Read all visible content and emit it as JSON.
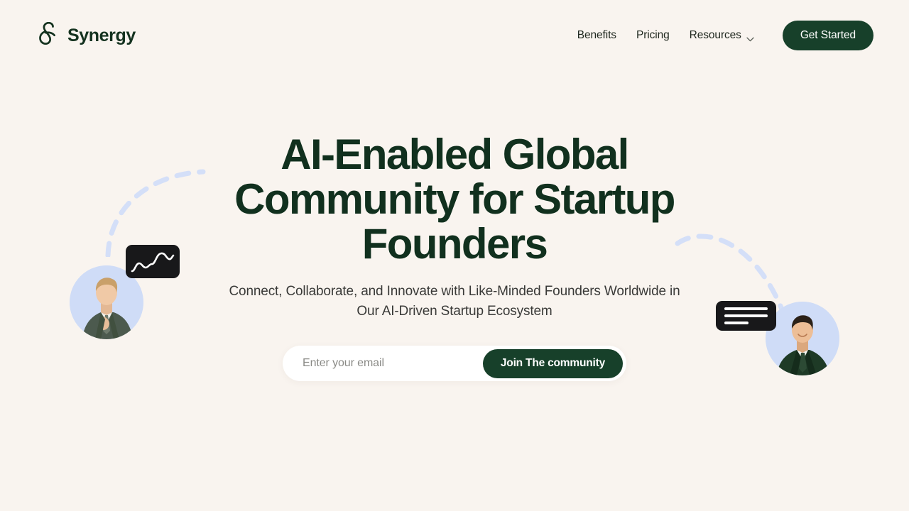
{
  "brand": {
    "name": "Synergy",
    "logo_icon": "ampersand-curl-logo-icon",
    "color": "#14321F"
  },
  "header": {
    "nav": [
      {
        "label": "Benefits",
        "icon": null
      },
      {
        "label": "Pricing",
        "icon": null
      },
      {
        "label": "Resources",
        "icon": "chevron-down-icon"
      }
    ],
    "cta": {
      "label": "Get Started",
      "background": "#17402A",
      "text_color": "#FFFFFF"
    }
  },
  "hero": {
    "title": "AI-Enabled Global Community for Startup Founders",
    "subtitle": "Connect, Collaborate, and Innovate with Like-Minded Founders Worldwide in Our AI-Driven Startup Ecosystem",
    "title_color": "#11301E",
    "subtitle_color": "#3A3A38"
  },
  "signup": {
    "placeholder": "Enter your email",
    "value": "",
    "button_label": "Join The community",
    "button_background": "#17402A",
    "field_background": "#FFFFFF"
  },
  "decorations": {
    "background_color": "#F9F4EF",
    "arc_color": "#D4DFF8",
    "avatar_ring_color": "#CFDCF7",
    "card_background": "#18181A",
    "left": {
      "arc": "dashed-arc-left",
      "card": "line-chart-card",
      "avatar": "founder-avatar-left"
    },
    "right": {
      "arc": "dashed-arc-right",
      "card": "text-lines-card",
      "avatar": "founder-avatar-right"
    }
  }
}
